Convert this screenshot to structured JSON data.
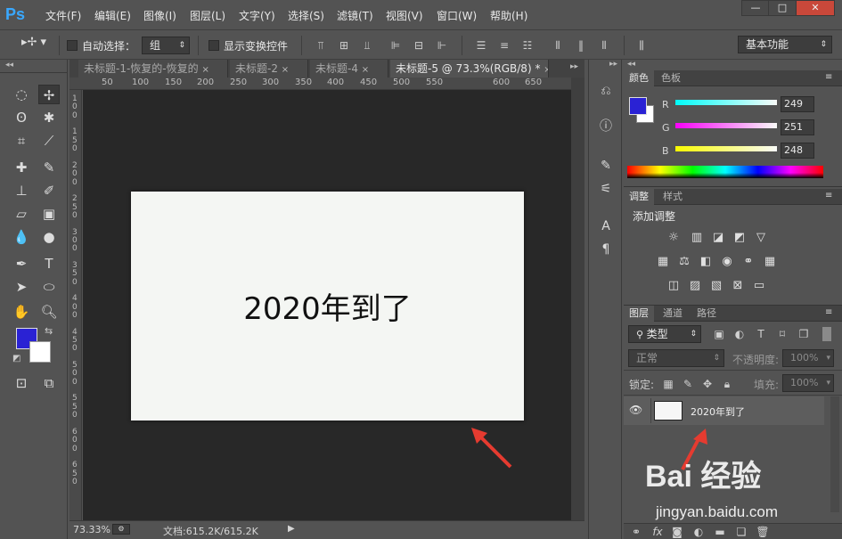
{
  "app": {
    "logo": "Ps"
  },
  "menu": [
    "文件(F)",
    "编辑(E)",
    "图像(I)",
    "图层(L)",
    "文字(Y)",
    "选择(S)",
    "滤镜(T)",
    "视图(V)",
    "窗口(W)",
    "帮助(H)"
  ],
  "window_controls": {
    "minimize": "—",
    "maximize": "□",
    "close": "✕"
  },
  "options": {
    "auto_select_label": "自动选择：",
    "auto_select_value": "组",
    "show_transform_label": "显示变换控件",
    "workspace": "基本功能"
  },
  "tabs": [
    {
      "label": "未标题-1-恢复的-恢复的",
      "close": "×"
    },
    {
      "label": "未标题-2",
      "close": "×"
    },
    {
      "label": "未标题-4",
      "close": "×"
    },
    {
      "label": "未标题-5 @ 73.3%(RGB/8) *",
      "close": "×"
    }
  ],
  "ruler_h": [
    "50",
    "100",
    "150",
    "200",
    "250",
    "300",
    "350",
    "400",
    "450",
    "500",
    "550",
    "600",
    "650"
  ],
  "ruler_v": [
    "1",
    "0",
    "0",
    "1",
    "5",
    "0",
    "2",
    "0",
    "0",
    "2",
    "5",
    "0",
    "3",
    "0",
    "0",
    "3",
    "5",
    "0",
    "4",
    "0",
    "0",
    "4",
    "5",
    "0",
    "5",
    "0",
    "0",
    "5",
    "5",
    "0",
    "6",
    "0",
    "0",
    "6",
    "5",
    "0"
  ],
  "document": {
    "text": "2020年到了"
  },
  "status": {
    "zoom": "73.33%",
    "docinfo": "文档:615.2K/615.2K"
  },
  "color_panel": {
    "tabs": [
      "颜色",
      "色板"
    ],
    "fg_color": "#2a22d4",
    "bg_color": "#ffffff",
    "channels": [
      {
        "label": "R",
        "value": "249"
      },
      {
        "label": "G",
        "value": "251"
      },
      {
        "label": "B",
        "value": "248"
      }
    ]
  },
  "adjust_panel": {
    "tabs": [
      "调整",
      "样式"
    ],
    "heading": "添加调整"
  },
  "layers_panel": {
    "tabs": [
      "图层",
      "通道",
      "路径"
    ],
    "filter_label": "类型",
    "blend_mode": "正常",
    "opacity_label": "不透明度:",
    "opacity_value": "100%",
    "lock_label": "锁定:",
    "fill_label": "填充:",
    "fill_value": "100%",
    "layer_name": "2020年到了"
  },
  "watermark": {
    "brand": "Bai 经验",
    "url": "jingyan.baidu.com"
  },
  "accent_colors": {
    "ps_blue": "#39a8ff",
    "arrow_red": "#e53b30"
  }
}
